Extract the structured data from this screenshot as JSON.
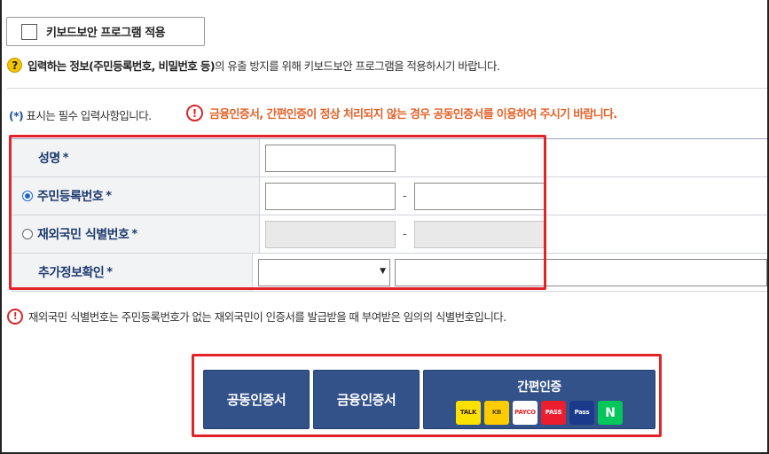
{
  "keyboard_security": {
    "label": "키보드보안 프로그램 적용",
    "checked": false
  },
  "notice": {
    "bold_text": "입력하는 정보(주민등록번호, 비밀번호 등)",
    "rest_text": "의 유출 방지를 위해 키보드보안 프로그램을 적용하시기 바랍니다."
  },
  "required_note": {
    "star": "(*)",
    "text": " 표시는 필수 입력사항입니다."
  },
  "warning": {
    "text": "금융인증서, 간편인증이 정상 처리되지 않는 경우 공동인증서를 이용하여 주시기 바랍니다."
  },
  "form": {
    "name_label": "성명",
    "resident_label": "주민등록번호",
    "foreigner_label": "재외국민 식별번호",
    "extra_label": "추가정보확인",
    "star": "*",
    "dash": "-",
    "resident_selected": true,
    "select_value": ""
  },
  "footnote": {
    "text": "재외국민 식별번호는 주민등록번호가 없는 재외국민이 인증서를 발급받을 때 부여받은 임의의 식별번호입니다."
  },
  "buttons": {
    "joint_cert": "공동인증서",
    "financial_cert": "금융인증서",
    "simple_auth": "간편인증",
    "providers": [
      {
        "name": "kakao",
        "text": "TALK",
        "bg": "#fae100",
        "fg": "#3c1e1e"
      },
      {
        "name": "kb",
        "text": "KB",
        "bg": "#ffcc00",
        "fg": "#5a4a00"
      },
      {
        "name": "payco",
        "text": "PAYCO",
        "bg": "#ffffff",
        "fg": "#e02020"
      },
      {
        "name": "pass-red",
        "text": "PASS",
        "bg": "#ec1d2e",
        "fg": "#ffffff"
      },
      {
        "name": "pass-blue",
        "text": "Pass",
        "bg": "#1b3a8c",
        "fg": "#ffffff"
      },
      {
        "name": "naver",
        "text": "N",
        "bg": "#03c75a",
        "fg": "#ffffff"
      }
    ]
  },
  "colors": {
    "warning": "#e2632c",
    "highlight_box": "#e2232a",
    "button": "#33528a"
  }
}
